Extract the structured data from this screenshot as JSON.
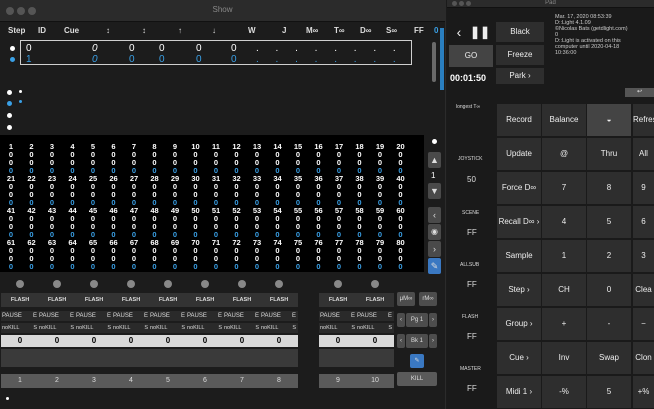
{
  "show": {
    "title": "Show",
    "headers": [
      "Step",
      "ID",
      "Cue",
      "↕",
      "↕",
      "↑",
      "↓",
      "W",
      "J",
      "M∞",
      "T∞",
      "D∞",
      "S∞",
      "FF"
    ],
    "ff_value": "0",
    "cue_row1": {
      "step": "0",
      "cue": "0",
      "v1": "0",
      "v2": "0",
      "v3": "0",
      "v4": "0",
      "dots": ". . . . . . . ."
    },
    "cue_row2": {
      "step": "1",
      "cue": "0",
      "v1": "0",
      "v2": "0",
      "v3": "0",
      "v4": "0",
      "dots": ". . . . . . . ."
    },
    "channels_row1": [
      "1",
      "2",
      "3",
      "4",
      "5",
      "6",
      "7",
      "8",
      "9",
      "10",
      "11",
      "12",
      "13",
      "14",
      "15",
      "16",
      "17",
      "18",
      "19",
      "20"
    ],
    "channels_row2": [
      "21",
      "22",
      "23",
      "24",
      "25",
      "26",
      "27",
      "28",
      "29",
      "30",
      "31",
      "32",
      "33",
      "34",
      "35",
      "36",
      "37",
      "38",
      "39",
      "40"
    ],
    "channels_row3": [
      "41",
      "42",
      "43",
      "44",
      "45",
      "46",
      "47",
      "48",
      "49",
      "50",
      "51",
      "52",
      "53",
      "54",
      "55",
      "56",
      "57",
      "58",
      "59",
      "60"
    ],
    "channels_row4": [
      "61",
      "62",
      "63",
      "64",
      "65",
      "66",
      "67",
      "68",
      "69",
      "70",
      "71",
      "72",
      "73",
      "74",
      "75",
      "76",
      "77",
      "78",
      "79",
      "80"
    ],
    "channel_value": "0",
    "side_page": "1",
    "faders": {
      "flash_label": "FLASH",
      "pause_label": "PAUSE",
      "e_label": "E",
      "nokill_label": "noKILL",
      "s_label": "S",
      "level": "0",
      "numbers": [
        "1",
        "2",
        "3",
        "4",
        "5",
        "6",
        "7",
        "8",
        "9",
        "10"
      ]
    },
    "mmm": "μM∞",
    "rmm": "rM∞",
    "pg": "Pg 1",
    "bk": "Bk 1",
    "kill": "KILL"
  },
  "pad": {
    "title": "Pad",
    "black": "Black",
    "go": "GO",
    "freeze": "Freeze",
    "timer": "00:01:50",
    "park": "Park ›",
    "info1": "Mar. 17, 2020 08:53:39",
    "info2": "D::Light 4.1.09",
    "info3": "©Nicolas Bats (getdlight.com)",
    "info4": "0",
    "info5": "D::Light is activated on this",
    "info6": "computer until 2020-04-18",
    "info7": "10:36:00",
    "longest": "longest T∞",
    "joystick": "JOYSTICK",
    "joy_val": "50",
    "scene": "SCENE",
    "scene_val": "FF",
    "allsub": "ALLSUB",
    "allsub_val": "FF",
    "flash": "FLASH",
    "flash_val": "FF",
    "master": "MASTER",
    "master_val": "FF",
    "rows": [
      [
        "Record",
        "Balance",
        "◒",
        "Refres"
      ],
      [
        "Update",
        "@",
        "Thru",
        "All"
      ],
      [
        "Force D∞",
        "7",
        "8",
        "9"
      ],
      [
        "Recall D∞ ›",
        "4",
        "5",
        "6"
      ],
      [
        "Sample",
        "1",
        "2",
        "3"
      ],
      [
        "Step ›",
        "CH",
        "0",
        "Clea"
      ],
      [
        "Group ›",
        "+",
        "-",
        "−"
      ],
      [
        "Cue ›",
        "Inv",
        "Swap",
        "Clon"
      ],
      [
        "Midi 1 ›",
        "-%",
        "5",
        "+%"
      ]
    ]
  }
}
